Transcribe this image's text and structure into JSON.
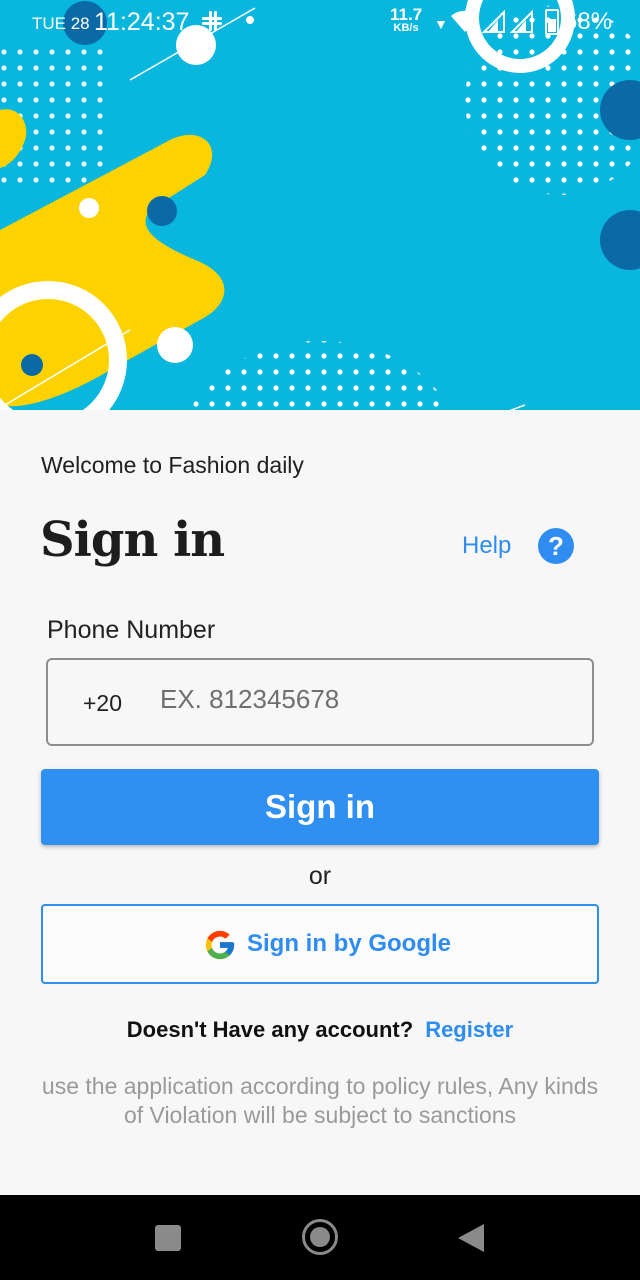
{
  "status_bar": {
    "date": "TUE 28",
    "time": "11:24:37",
    "net_speed": "11.7",
    "net_unit": "KB/s",
    "battery": "68%"
  },
  "header": {
    "welcome": "Welcome to Fashion daily",
    "title": "Sign in",
    "help_label": "Help",
    "help_icon_glyph": "?"
  },
  "form": {
    "phone_label": "Phone Number",
    "country_code": "+20",
    "phone_placeholder": "EX. 812345678",
    "phone_value": ""
  },
  "actions": {
    "signin_label": "Sign in",
    "or_label": "or",
    "google_label": "Sign in by Google"
  },
  "footer": {
    "no_account": "Doesn't Have any account?",
    "register_label": "Register",
    "policy": "use the application according to policy rules, Any kinds of Violation will be subject to sanctions"
  },
  "colors": {
    "accent": "#2f90f2",
    "hero_bg": "#08b6de",
    "hero_yellow": "#fcd300",
    "link": "#2f8cf0"
  },
  "icons": [
    "slack-icon",
    "wifi-icon",
    "signal-icon",
    "battery-icon",
    "help-icon",
    "google-icon",
    "recent-apps-icon",
    "home-icon",
    "back-icon"
  ]
}
